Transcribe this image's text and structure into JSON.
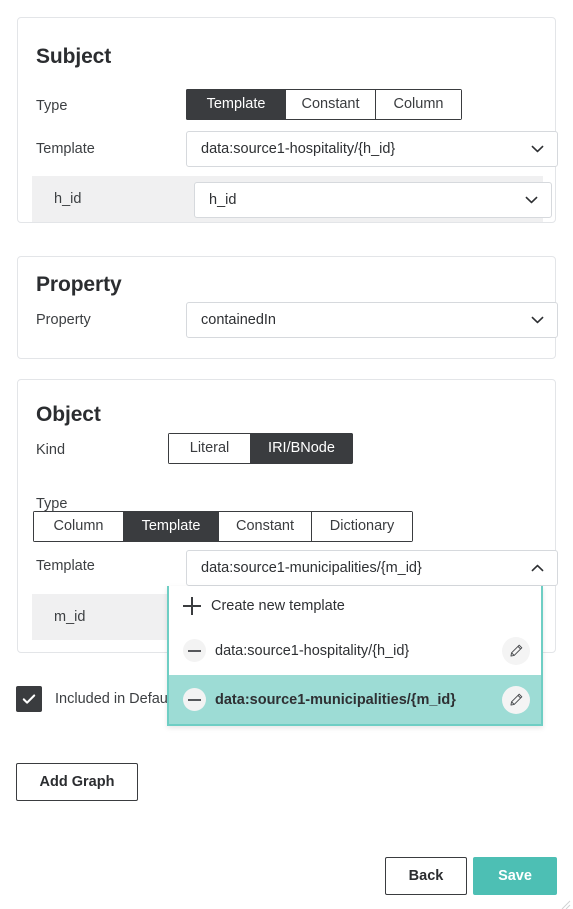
{
  "subject": {
    "title": "Subject",
    "type_label": "Type",
    "type_options": [
      "Template",
      "Constant",
      "Column"
    ],
    "type_selected": "Template",
    "template_label": "Template",
    "template_value": "data:source1-hospitality/{h_id}",
    "variable_name": "h_id",
    "variable_value": "h_id"
  },
  "property": {
    "title": "Property",
    "label": "Property",
    "value": "containedIn"
  },
  "object": {
    "title": "Object",
    "kind_label": "Kind",
    "kind_options": [
      "Literal",
      "IRI/BNode"
    ],
    "kind_selected": "IRI/BNode",
    "type_label": "Type",
    "type_options": [
      "Column",
      "Template",
      "Constant",
      "Dictionary"
    ],
    "type_selected": "Template",
    "template_label": "Template",
    "template_value": "data:source1-municipalities/{m_id}",
    "variable_name": "m_id"
  },
  "template_dropdown": {
    "create_label": "Create new template",
    "items": [
      {
        "label": "data:source1-hospitality/{h_id}",
        "selected": false
      },
      {
        "label": "data:source1-municipalities/{m_id}",
        "selected": true
      }
    ]
  },
  "included_checkbox": {
    "label": "Included in Defau",
    "checked": true
  },
  "actions": {
    "add_graph": "Add Graph",
    "back": "Back",
    "save": "Save"
  },
  "colors": {
    "accent_teal": "#4dbfb4",
    "highlight_teal": "#9ddcd5",
    "dark": "#3a3c3f",
    "strip_gray": "#f0f0f1"
  }
}
